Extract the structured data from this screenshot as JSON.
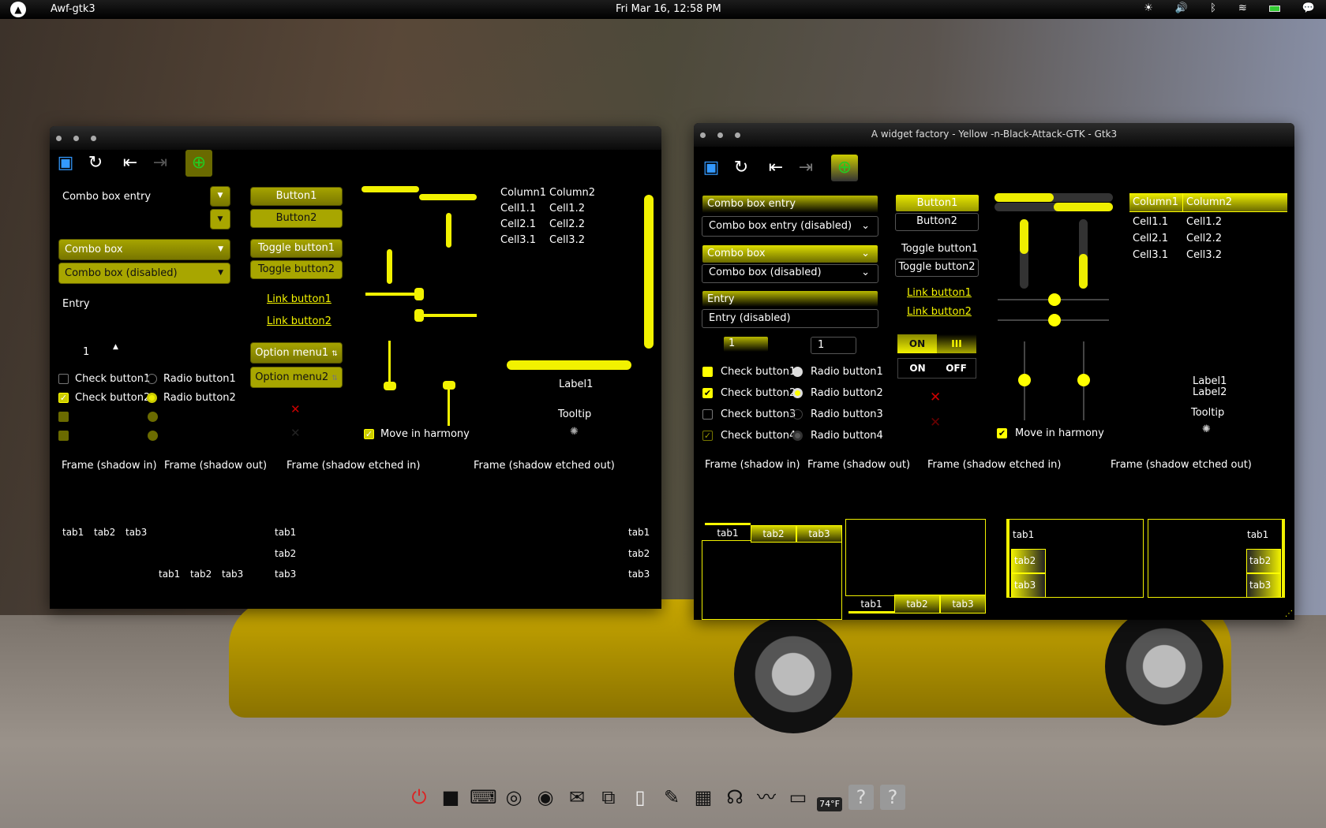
{
  "panel": {
    "app_name": "Awf-gtk3",
    "clock": "Fri Mar 16, 12:58 PM",
    "tray": [
      "brightness-icon",
      "volume-icon",
      "bluetooth-icon",
      "wifi-icon",
      "battery-icon",
      "chat-icon"
    ]
  },
  "left_window": {
    "title": "",
    "toolbar": [
      "open-icon",
      "refresh-icon",
      "go-first-icon",
      "go-last-icon",
      "add-icon"
    ],
    "combo_entry": "Combo box entry",
    "combo_box": "Combo box",
    "combo_box_disabled": "Combo box (disabled)",
    "entry": "Entry",
    "spin_value": "1",
    "checks": [
      "Check button1",
      "Check button2"
    ],
    "radios": [
      "Radio button1",
      "Radio button2"
    ],
    "buttons": [
      "Button1",
      "Button2"
    ],
    "toggles": [
      "Toggle button1",
      "Toggle button2"
    ],
    "links": [
      "Link button1",
      "Link button2"
    ],
    "option_menus": [
      "Option menu1",
      "Option menu2"
    ],
    "tree": {
      "columns": [
        "Column1",
        "Column2"
      ],
      "rows": [
        [
          "Cell1.1",
          "Cell1.2"
        ],
        [
          "Cell2.1",
          "Cell2.2"
        ],
        [
          "Cell3.1",
          "Cell3.2"
        ]
      ]
    },
    "label1": "Label1",
    "tooltip": "Tooltip",
    "harmony": "Move in harmony",
    "frames": [
      "Frame (shadow in)",
      "Frame (shadow out)",
      "Frame (shadow etched in)",
      "Frame (shadow etched out)"
    ],
    "tabs": [
      "tab1",
      "tab2",
      "tab3"
    ],
    "progress": {
      "h1": 0.5,
      "h2": 0.5,
      "v1": 0.5,
      "v2": 0.5
    },
    "scales": {
      "h1": 0.5,
      "h2": 0.5,
      "v1": 1.0,
      "v2": 0.0
    }
  },
  "right_window": {
    "title": "A widget factory - Yellow -n-Black-Attack-GTK - Gtk3",
    "toolbar": [
      "open-icon",
      "refresh-icon",
      "go-first-icon",
      "go-last-icon",
      "add-icon"
    ],
    "combo_entry": "Combo box entry",
    "combo_entry_disabled": "Combo box entry (disabled)",
    "combo_box": "Combo box",
    "combo_box_disabled": "Combo box (disabled)",
    "entry": "Entry",
    "entry_disabled": "Entry (disabled)",
    "spin1": "1",
    "spin2": "1",
    "checks": [
      "Check button1",
      "Check button2",
      "Check button3",
      "Check button4"
    ],
    "radios": [
      "Radio button1",
      "Radio button2",
      "Radio button3",
      "Radio button4"
    ],
    "buttons": [
      "Button1",
      "Button2"
    ],
    "toggles": [
      "Toggle button1",
      "Toggle button2"
    ],
    "links": [
      "Link button1",
      "Link button2"
    ],
    "switch_on": {
      "on": "ON",
      "off": "III"
    },
    "switch_off": {
      "on": "ON",
      "off": "OFF"
    },
    "tree": {
      "columns": [
        "Column1",
        "Column2"
      ],
      "rows": [
        [
          "Cell1.1",
          "Cell1.2"
        ],
        [
          "Cell2.1",
          "Cell2.2"
        ],
        [
          "Cell3.1",
          "Cell3.2"
        ]
      ]
    },
    "label1": "Label1",
    "label2": "Label2",
    "tooltip": "Tooltip",
    "harmony": "Move in harmony",
    "frames": [
      "Frame (shadow in)",
      "Frame (shadow out)",
      "Frame (shadow etched in)",
      "Frame (shadow etched out)"
    ],
    "tabs": [
      "tab1",
      "tab2",
      "tab3"
    ],
    "progress": {
      "h1": 0.5,
      "h2": 0.5,
      "v1": 0.5,
      "v2": 0.5
    },
    "scales": {
      "h1": 0.5,
      "h2": 0.5,
      "v1": 0.5,
      "v2": 0.5
    }
  },
  "dock": {
    "items": [
      "power-icon",
      "terminal-black-icon",
      "terminal-icon",
      "chrome-icon",
      "firefox-icon",
      "mail-icon",
      "remote-desktop-icon",
      "document-icon",
      "pen-icon",
      "calculator-icon",
      "headphones-icon",
      "system-monitor-icon",
      "display-icon",
      "weather-icon",
      "unknown-icon",
      "unknown-icon"
    ],
    "weather": "74°F"
  },
  "colors": {
    "accent": "#f2f200",
    "dark_accent": "#8a8800",
    "bg": "#000000",
    "error": "#cc0000"
  }
}
